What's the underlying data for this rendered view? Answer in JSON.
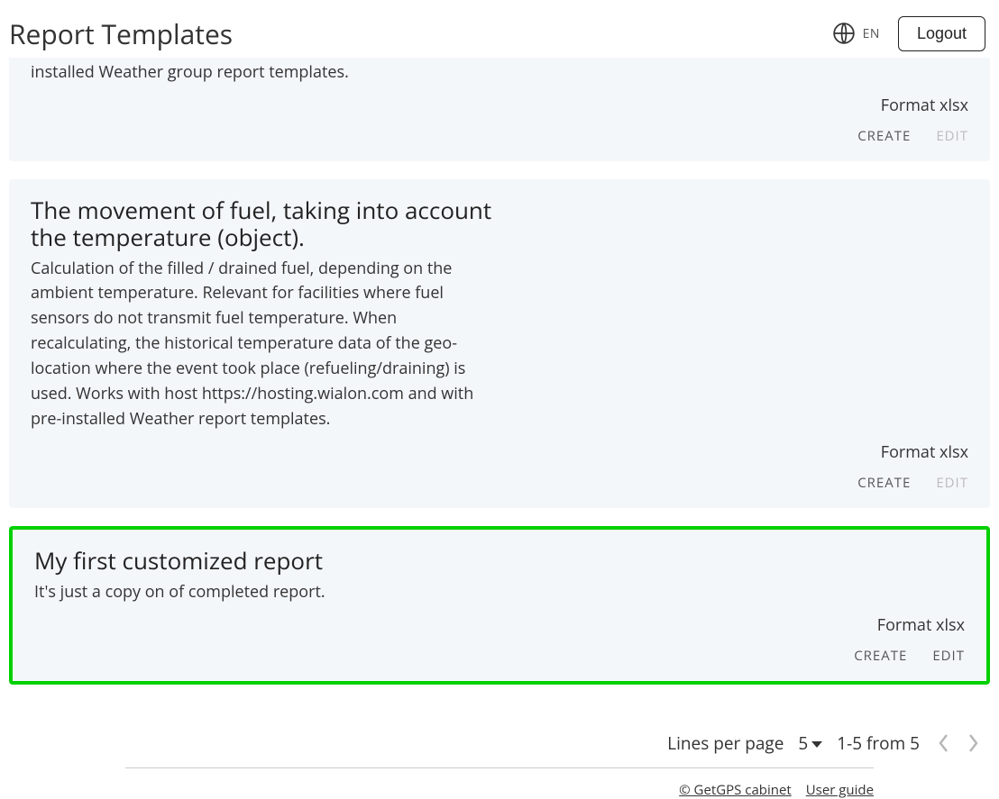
{
  "header": {
    "title": "Report Templates",
    "language": "EN",
    "logout": "Logout"
  },
  "cards": [
    {
      "title": "",
      "desc_tail": "used. Works with host https://hosting.wialon.com and pre-installed Weather group report templates.",
      "format_label": "Format xlsx",
      "create": "Create",
      "edit": "Edit",
      "edit_enabled": false,
      "highlight": false
    },
    {
      "title": "The movement of fuel, taking into account the temperature (object).",
      "desc": "Calculation of the filled / drained fuel, depending on the ambient temperature. Relevant for facilities where fuel sensors do not transmit fuel temperature. When recalculating, the historical temperature data of the geo-location where the event took place (refueling/draining) is used. Works with host https://hosting.wialon.com and with pre-installed Weather report templates.",
      "format_label": "Format xlsx",
      "create": "Create",
      "edit": "Edit",
      "edit_enabled": false,
      "highlight": false
    },
    {
      "title": "My first customized report",
      "desc": "It's just a copy on of completed report.",
      "format_label": "Format xlsx",
      "create": "Create",
      "edit": "Edit",
      "edit_enabled": true,
      "highlight": true
    }
  ],
  "pagination": {
    "lpp_label": "Lines per page",
    "lpp_value": "5",
    "range": "1-5 from 5"
  },
  "footer": {
    "link1": "© GetGPS cabinet",
    "link2": "User guide"
  }
}
